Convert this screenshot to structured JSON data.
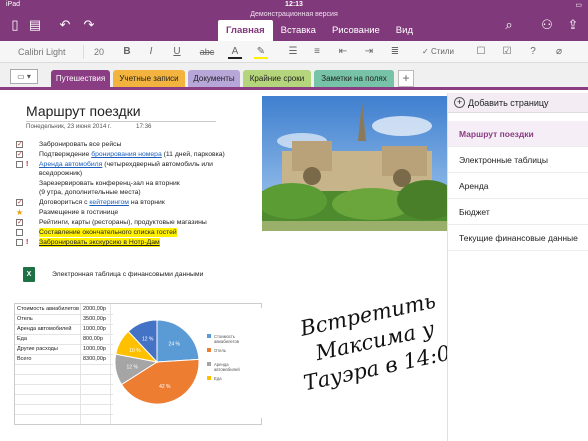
{
  "status": {
    "device": "iPad",
    "time": "12:13",
    "battery": "▭"
  },
  "app": {
    "doc_title": "Демонстрационная версия"
  },
  "ribbon_tabs": [
    "Главная",
    "Вставка",
    "Рисование",
    "Вид"
  ],
  "ribbon": {
    "font_name": "Calibri Light",
    "font_size": "20",
    "styles_label": "Стили"
  },
  "sections": [
    {
      "label": "Путешествия",
      "color": "#8a3d82"
    },
    {
      "label": "Учетные записи",
      "color": "#f3b43f"
    },
    {
      "label": "Документы",
      "color": "#b7a7d9"
    },
    {
      "label": "Крайние сроки",
      "color": "#b5d57c"
    },
    {
      "label": "Заметки на полях",
      "color": "#77c3a7"
    }
  ],
  "page": {
    "title": "Маршрут поездки",
    "date": "Понедельник, 23 июня 2014 г.",
    "time": "17:36",
    "todos": [
      {
        "pre": "Забронировать все рейсы",
        "link": "",
        "post": ""
      },
      {
        "pre": "Подтверждение ",
        "link": "бронирования номера",
        "post": " (11 дней, парковка)"
      },
      {
        "pre": "",
        "link": "Аренда автомобиля",
        "post": " (четырехдверный автомобиль или"
      },
      {
        "pre": "вседорожник)",
        "link": "",
        "post": ""
      },
      {
        "pre": "Зарезервировать конференц-зал на вторник",
        "link": "",
        "post": ""
      },
      {
        "pre": "(9 утра, дополнительные места)",
        "link": "",
        "post": ""
      },
      {
        "pre": "Договориться с ",
        "link": "кейтерингом",
        "post": " на вторник"
      },
      {
        "pre": "Размещение в гостинице",
        "link": "",
        "post": ""
      },
      {
        "pre": "Рейтинги, карты (рестораны), продуктовые магазины",
        "link": "",
        "post": ""
      },
      {
        "pre": "Составление окончательного списка гостей",
        "link": "",
        "post": ""
      },
      {
        "pre": "Забронировать экскурсию в Нотр-Дам",
        "link": "",
        "post": ""
      }
    ],
    "important_mark": "!",
    "excel_label": "Электронная таблица с финансовыми данными",
    "excel_icon_text": "X",
    "sheet_rows": [
      {
        "label": "Стоимость авиабилетов",
        "value": "2000,00р"
      },
      {
        "label": "Отель",
        "value": "3500,00р"
      },
      {
        "label": "Аренда автомобилей",
        "value": "1000,00р"
      },
      {
        "label": "Еда",
        "value": "800,00р"
      },
      {
        "label": "Другие расходы",
        "value": "1000,00р"
      },
      {
        "label": "Всего",
        "value": "8300,00р"
      }
    ],
    "handwriting": [
      "Встретить",
      "Максима у",
      "Тауэра в 14:00"
    ]
  },
  "chart_data": {
    "type": "pie",
    "slices": [
      {
        "label": "Стоимость авиабилетов",
        "value": 24,
        "color": "#5b9bd5"
      },
      {
        "label": "Отель",
        "value": 42,
        "color": "#ed7d31"
      },
      {
        "label": "Аренда автомобилей",
        "value": 12,
        "color": "#a5a5a5"
      },
      {
        "label": "Еда",
        "value": 10,
        "color": "#ffc000"
      },
      {
        "label": "Другие расходы",
        "value": 12,
        "color": "#4472c4"
      }
    ],
    "data_labels": [
      "24 %",
      "42 %",
      "12 %",
      "10 %",
      "12 %"
    ],
    "legend": [
      "Стоимость авиабилетов",
      "Отель",
      "Аренда автомобилей",
      "Еда"
    ],
    "legend_position": "right"
  },
  "pages_panel": {
    "add_label": "Добавить страницу",
    "items": [
      "Маршрут поездки",
      "Электронные таблицы",
      "Аренда",
      "Бюджет",
      "Текущие финансовые данные"
    ]
  },
  "colors": {
    "accent": "#80397b",
    "link": "#1a5fbf",
    "highlight": "#fff000"
  }
}
